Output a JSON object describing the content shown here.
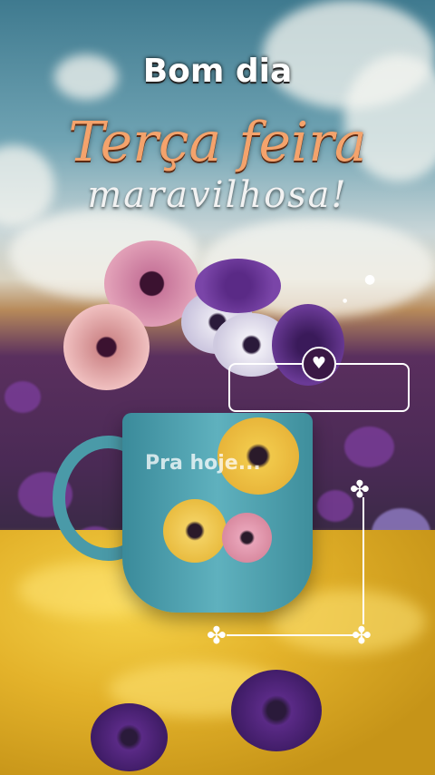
{
  "greeting": "Bom dia",
  "day": "Terça feira",
  "adjective": "maravilhosa!",
  "caption": "Pra hoje...",
  "icons": {
    "heart": "heart-icon",
    "flourish": "floral-ornament-icon"
  },
  "colors": {
    "day_text": "#f4a36c",
    "greeting_text": "#ffffff",
    "box_border": "#ffffff"
  }
}
